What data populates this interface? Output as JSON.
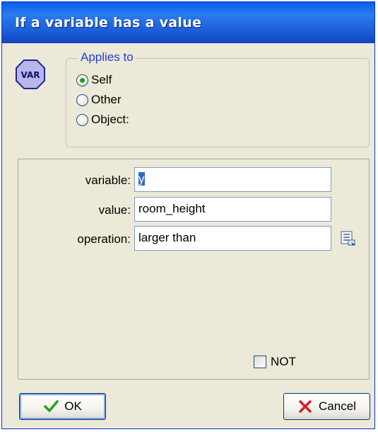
{
  "window": {
    "title": "If a variable has a value"
  },
  "icon": {
    "label": "VAR",
    "name": "var-icon"
  },
  "applies_to": {
    "legend": "Applies to",
    "options": [
      {
        "label": "Self",
        "checked": true
      },
      {
        "label": "Other",
        "checked": false
      },
      {
        "label": "Object:",
        "checked": false
      }
    ]
  },
  "fields": {
    "variable": {
      "label": "variable:",
      "value": "y"
    },
    "value": {
      "label": "value:",
      "value": "room_height"
    },
    "operation": {
      "label": "operation:",
      "value": "larger than"
    }
  },
  "not_checkbox": {
    "label": "NOT",
    "checked": false
  },
  "buttons": {
    "ok_label": "OK",
    "cancel_label": "Cancel"
  },
  "colors": {
    "title_bar": "#1c5ed8",
    "dialog_bg": "#ece9d8",
    "legend_text": "#1f3fd1",
    "ok_check": "#21a121",
    "cancel_x": "#d4202a",
    "selection": "#316ac5"
  }
}
